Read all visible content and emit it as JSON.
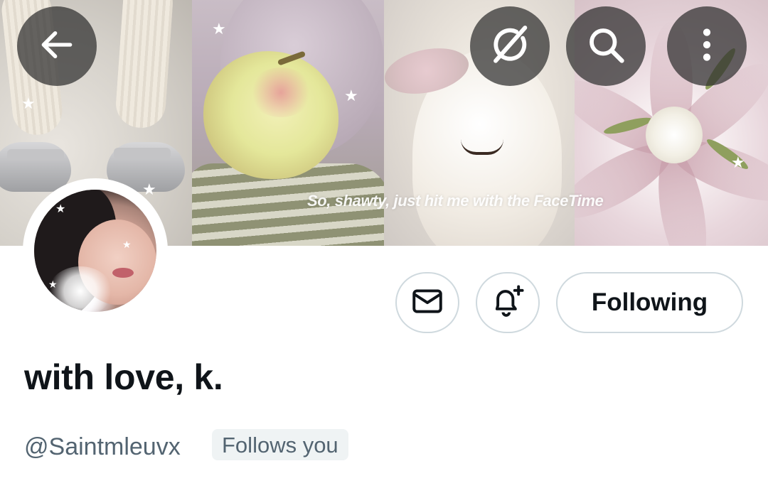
{
  "header": {
    "back_icon": "arrow-left-icon",
    "grok_icon": "grok-icon",
    "search_icon": "search-icon",
    "more_icon": "more-vertical-icon"
  },
  "banner": {
    "caption": "So, shawty, just hit me with the FaceTime"
  },
  "actions": {
    "message_icon": "envelope-icon",
    "notify_icon": "bell-plus-icon",
    "following_label": "Following"
  },
  "profile": {
    "display_name": "with love, k.",
    "handle": "@Saintmleuvx",
    "follows_you": "Follows you"
  },
  "colors": {
    "text_primary": "#0f1419",
    "text_secondary": "#536471",
    "badge_bg": "#eff3f4",
    "button_border": "#cfd9de",
    "overlay_btn": "#2e2e2e"
  }
}
